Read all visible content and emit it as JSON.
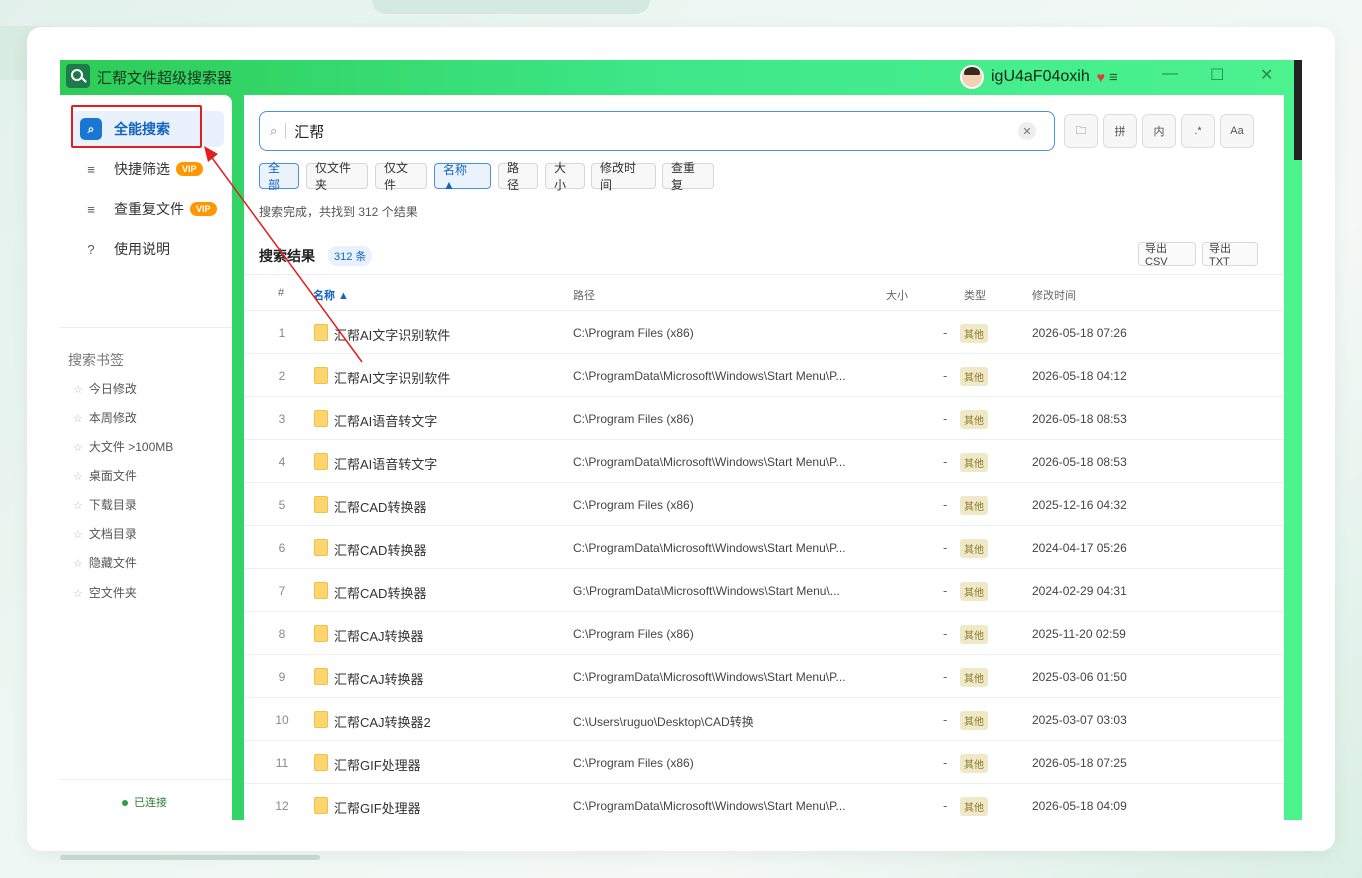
{
  "app": {
    "title": "汇帮文件超级搜索器",
    "user": "igU4aF04oxih",
    "vip_gem": "♥",
    "menu": "≡",
    "minimize": "—",
    "maximize": "☐",
    "close": "✕"
  },
  "sidebar": {
    "items": [
      {
        "label": "全能搜索",
        "icon": "search-icon",
        "glyph": "⌕",
        "active": true
      },
      {
        "label": "快捷筛选",
        "icon": "filter-icon",
        "glyph": "≡",
        "vip": "VIP"
      },
      {
        "label": "查重复文件",
        "icon": "duplicate-icon",
        "glyph": "≡",
        "vip": "VIP"
      },
      {
        "label": "使用说明",
        "icon": "help-icon",
        "glyph": "?"
      }
    ],
    "bookmarks_title": "搜索书签",
    "bookmarks": [
      "今日修改",
      "本周修改",
      "大文件 >100MB",
      "桌面文件",
      "下载目录",
      "文档目录",
      "隐藏文件",
      "空文件夹"
    ],
    "status": "已连接"
  },
  "search": {
    "value": "汇帮",
    "clear": "✕",
    "tools": [
      {
        "name": "folder-icon",
        "label": "🗀"
      },
      {
        "name": "pinyin-button",
        "label": "拼"
      },
      {
        "name": "content-button",
        "label": "内"
      },
      {
        "name": "regex-button",
        "label": ".*"
      },
      {
        "name": "case-button",
        "label": "Aa"
      }
    ]
  },
  "chips": [
    "全部",
    "仅文件夹",
    "仅文件",
    "名称 ▲",
    "路径",
    "大小",
    "修改时间",
    "查重复"
  ],
  "summary": "搜索完成，共找到 312 个结果",
  "results": {
    "title": "搜索结果",
    "count": "312 条",
    "export_csv": "导出CSV",
    "export_txt": "导出TXT",
    "headers": {
      "num": "#",
      "name": "名称 ▲",
      "path": "路径",
      "size": "大小",
      "type": "类型",
      "time": "修改时间"
    },
    "rows": [
      {
        "num": "1",
        "name": "汇帮AI文字识别软件",
        "path": "C:\\Program Files (x86)",
        "size": "-",
        "type": "其他",
        "time": "2026-05-18 07:26"
      },
      {
        "num": "2",
        "name": "汇帮AI文字识别软件",
        "path": "C:\\ProgramData\\Microsoft\\Windows\\Start Menu\\P...",
        "size": "-",
        "type": "其他",
        "time": "2026-05-18 04:12"
      },
      {
        "num": "3",
        "name": "汇帮AI语音转文字",
        "path": "C:\\Program Files (x86)",
        "size": "-",
        "type": "其他",
        "time": "2026-05-18 08:53"
      },
      {
        "num": "4",
        "name": "汇帮AI语音转文字",
        "path": "C:\\ProgramData\\Microsoft\\Windows\\Start Menu\\P...",
        "size": "-",
        "type": "其他",
        "time": "2026-05-18 08:53"
      },
      {
        "num": "5",
        "name": "汇帮CAD转换器",
        "path": "C:\\Program Files (x86)",
        "size": "-",
        "type": "其他",
        "time": "2025-12-16 04:32"
      },
      {
        "num": "6",
        "name": "汇帮CAD转换器",
        "path": "C:\\ProgramData\\Microsoft\\Windows\\Start Menu\\P...",
        "size": "-",
        "type": "其他",
        "time": "2024-04-17 05:26"
      },
      {
        "num": "7",
        "name": "汇帮CAD转换器",
        "path": "G:\\ProgramData\\Microsoft\\Windows\\Start Menu\\...",
        "size": "-",
        "type": "其他",
        "time": "2024-02-29 04:31"
      },
      {
        "num": "8",
        "name": "汇帮CAJ转换器",
        "path": "C:\\Program Files (x86)",
        "size": "-",
        "type": "其他",
        "time": "2025-11-20 02:59"
      },
      {
        "num": "9",
        "name": "汇帮CAJ转换器",
        "path": "C:\\ProgramData\\Microsoft\\Windows\\Start Menu\\P...",
        "size": "-",
        "type": "其他",
        "time": "2025-03-06 01:50"
      },
      {
        "num": "10",
        "name": "汇帮CAJ转换器2",
        "path": "C:\\Users\\ruguo\\Desktop\\CAD转换",
        "size": "-",
        "type": "其他",
        "time": "2025-03-07 03:03"
      },
      {
        "num": "11",
        "name": "汇帮GIF处理器",
        "path": "C:\\Program Files (x86)",
        "size": "-",
        "type": "其他",
        "time": "2026-05-18 07:25"
      },
      {
        "num": "12",
        "name": "汇帮GIF处理器",
        "path": "C:\\ProgramData\\Microsoft\\Windows\\Start Menu\\P...",
        "size": "-",
        "type": "其他",
        "time": "2026-05-18 04:09"
      }
    ]
  },
  "colors": {
    "accent": "#1976d2",
    "titlebar": "#3ee88a",
    "highlight": "#e02020",
    "vip": "#ff9800"
  }
}
